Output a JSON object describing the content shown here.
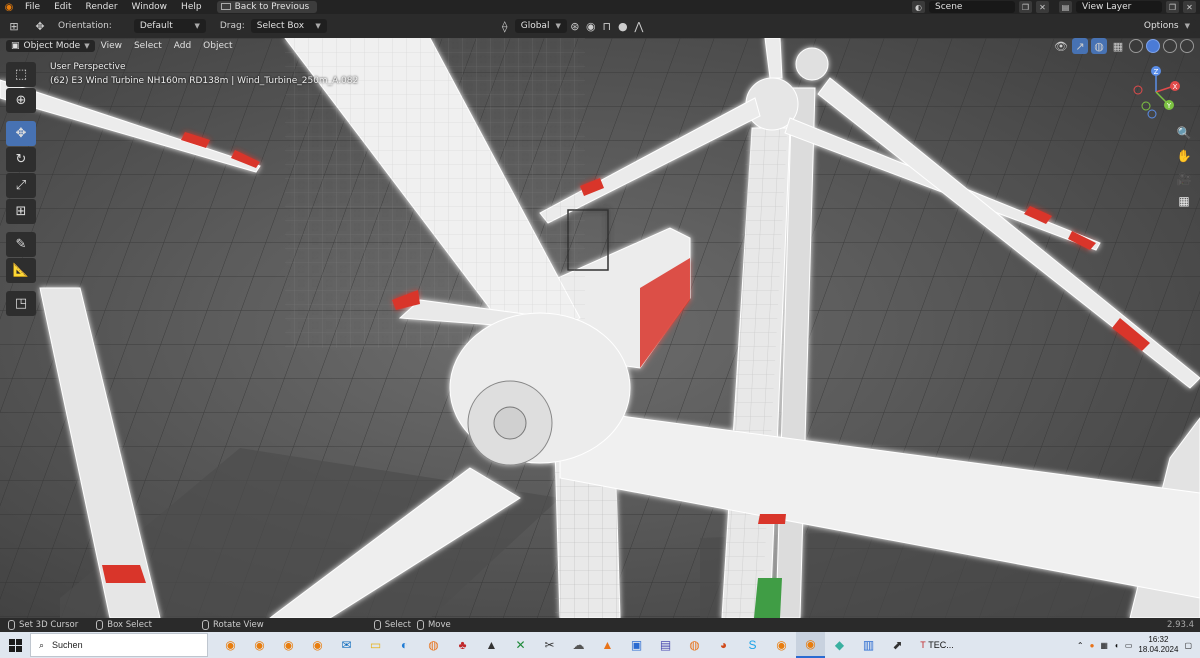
{
  "menubar": {
    "app_icon": "blender-icon",
    "items": [
      "File",
      "Edit",
      "Render",
      "Window",
      "Help"
    ],
    "back_button": "Back to Previous",
    "scene_label": "Scene",
    "view_layer_label": "View Layer"
  },
  "toolheader": {
    "orientation_label": "Orientation:",
    "orientation_value": "Default",
    "drag_label": "Drag:",
    "drag_value": "Select Box",
    "transform_orientation": "Global",
    "options_label": "Options"
  },
  "viewport_header": {
    "mode": "Object Mode",
    "menus": [
      "View",
      "Select",
      "Add",
      "Object"
    ]
  },
  "viewport": {
    "perspective_label": "User Perspective",
    "object_info": "(62) E3 Wind Turbine NH160m RD138m | Wind_Turbine_250m_A.082",
    "gizmo_axes": [
      "X",
      "Y",
      "Z"
    ],
    "accent_color": "#4772b3",
    "blade_stripe_color": "#d9352a"
  },
  "toolbar": {
    "tools": [
      "select-box-icon",
      "cursor-icon",
      "move-icon",
      "rotate-icon",
      "scale-icon",
      "transform-icon",
      "annotate-icon",
      "measure-icon",
      "add-cube-icon"
    ]
  },
  "statusbar": {
    "items": [
      "Set 3D Cursor",
      "Box Select",
      "Rotate View",
      "Select",
      "Move"
    ],
    "version": "2.93.4"
  },
  "taskbar": {
    "search_placeholder": "Suchen",
    "app_label": "TEC...",
    "time": "16:32",
    "date": "18.04.2024"
  }
}
